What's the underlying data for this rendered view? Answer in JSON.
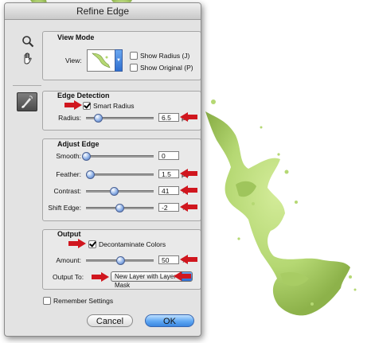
{
  "window": {
    "title": "Refine Edge"
  },
  "tools": {
    "zoom_icon": "zoom-tool-icon",
    "hand_icon": "hand-tool-icon",
    "brush_icon": "refine-radius-brush-icon"
  },
  "view_mode": {
    "heading": "View Mode",
    "view_label": "View:",
    "show_radius": {
      "label": "Show Radius (J)",
      "checked": false
    },
    "show_original": {
      "label": "Show Original (P)",
      "checked": false
    }
  },
  "edge_detection": {
    "heading": "Edge Detection",
    "smart_radius": {
      "label": "Smart Radius",
      "checked": true
    },
    "radius": {
      "label": "Radius:",
      "value": "6.5",
      "unit": "px",
      "slider_fraction": 0.18
    }
  },
  "adjust_edge": {
    "heading": "Adjust Edge",
    "smooth": {
      "label": "Smooth:",
      "value": "0",
      "unit": "",
      "slider_fraction": 0.0
    },
    "feather": {
      "label": "Feather:",
      "value": "1.5",
      "unit": "px",
      "slider_fraction": 0.06
    },
    "contrast": {
      "label": "Contrast:",
      "value": "41",
      "unit": "%",
      "slider_fraction": 0.41
    },
    "shift_edge": {
      "label": "Shift Edge:",
      "value": "-2",
      "unit": "%",
      "slider_fraction": 0.49
    }
  },
  "output": {
    "heading": "Output",
    "decontaminate": {
      "label": "Decontaminate Colors",
      "checked": true
    },
    "amount": {
      "label": "Amount:",
      "value": "50",
      "unit": "%",
      "slider_fraction": 0.5
    },
    "output_to": {
      "label": "Output To:",
      "value": "New Layer with Layer Mask"
    }
  },
  "remember_settings": {
    "label": "Remember Settings",
    "checked": false
  },
  "buttons": {
    "cancel": "Cancel",
    "ok": "OK"
  },
  "colors": {
    "splash": "#b5d873",
    "splash_dark": "#8fb84e",
    "arrow": "#d0161e",
    "ok_button": "#5ea7f3"
  }
}
